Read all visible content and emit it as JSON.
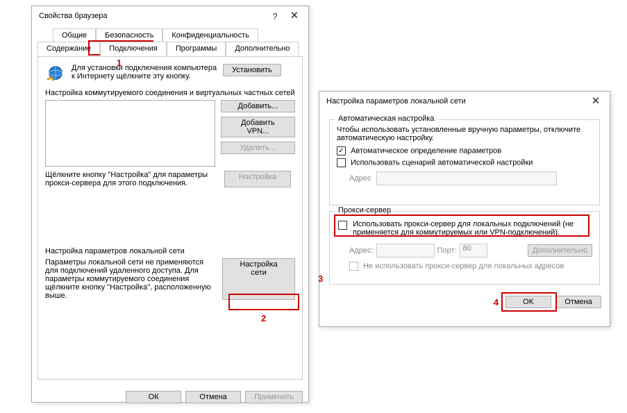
{
  "win1": {
    "title": "Свойства браузера",
    "help": "?",
    "close": "🗙",
    "tabs_row1": [
      "Общие",
      "Безопасность",
      "Конфиденциальность"
    ],
    "tabs_row2": [
      "Содержание",
      "Подключения",
      "Программы",
      "Дополнительно"
    ],
    "active_tab": "Подключения",
    "setup_text": "Для установки подключения компьютера к Интернету щёлкните эту кнопку.",
    "setup_btn": "Установить",
    "dial_title": "Настройка коммутируемого соединения и виртуальных частных сетей",
    "add_btn": "Добавить...",
    "add_vpn_btn": "Добавить VPN...",
    "remove_btn": "Удалить...",
    "settings_btn": "Настройка",
    "settings_hint": "Щёлкните кнопку \"Настройка\" для параметры прокси-сервера для этого подключения.",
    "lan_title": "Настройка параметров локальной сети",
    "lan_text": "Параметры локальной сети не применяются для подключений удаленного доступа. Для параметры коммутируемого соединения щёлкните кнопку \"Настройка\", расположенную выше.",
    "lan_btn": "Настройка сети",
    "ok": "ОК",
    "cancel": "Отмена",
    "apply": "Применить"
  },
  "win2": {
    "title": "Настройка параметров локальной сети",
    "close": "🗙",
    "auto_group": "Автоматическая настройка",
    "auto_text": "Чтобы использовать установленные вручную параметры, отключите автоматическую настройку.",
    "auto_detect": "Автоматическое определение параметров",
    "auto_script": "Использовать сценарий автоматической настройки",
    "addr_label": "Адрес",
    "proxy_group": "Прокси-сервер",
    "proxy_use": "Использовать прокси-сервер для локальных подключений (не применяется для коммутируемых или VPN-подключений).",
    "addr2_label": "Адрес:",
    "port_label": "Порт:",
    "port_value": "80",
    "advanced_btn": "Дополнительно",
    "bypass_local": "Не использовать прокси-сервер для локальных адресов",
    "ok": "OK",
    "cancel": "Отмена"
  },
  "anno": {
    "n1": "1",
    "n2": "2",
    "n3": "3",
    "n4": "4"
  }
}
